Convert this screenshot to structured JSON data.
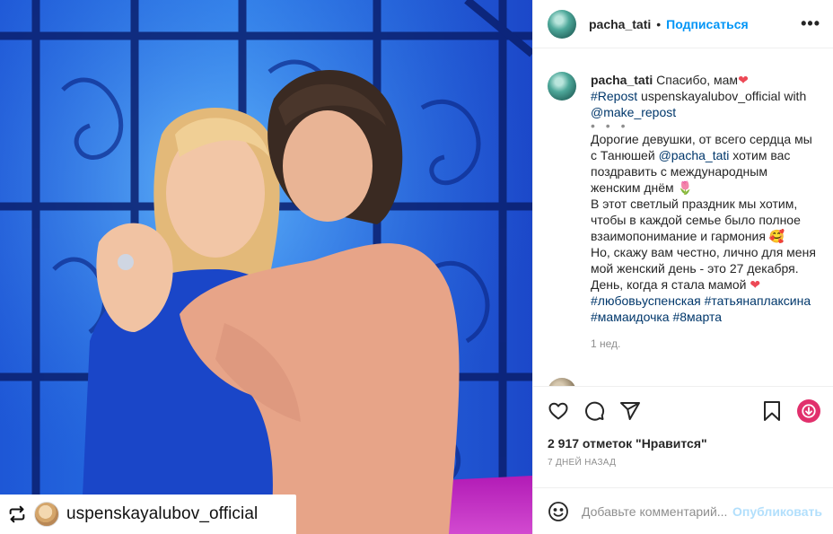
{
  "photo": {
    "repost_user": "uspenskayalubov_official",
    "alt": "Две женщины обнимаются на фоне синей студийной декорации"
  },
  "header": {
    "username": "pacha_tati",
    "separator": "•",
    "follow_label": "Подписаться",
    "more_label": "•••"
  },
  "caption": {
    "username": "pacha_tati",
    "lines": [
      {
        "pre": " Спасибо, мам",
        "heart": "❤"
      },
      {
        "tag": "#Repost",
        "rest": " uspenskayalubov_official with"
      },
      {
        "tag": "@make_repost"
      },
      {
        "bullets": "• • •"
      },
      {
        "text": "Дорогие девушки, от всего сердца мы"
      },
      {
        "pre": "с Танюшей ",
        "tag": "@pacha_tati",
        "rest": " хотим вас"
      },
      {
        "text": "поздравить с международным"
      },
      {
        "text": "женским днём ",
        "emoji": "🌷"
      },
      {
        "text": "В этот светлый праздник мы хотим,"
      },
      {
        "text": "чтобы в каждой семье было полное"
      },
      {
        "text": "взаимопонимание и гармония ",
        "emoji": "🥰"
      },
      {
        "text": "Но, скажу вам честно, лично для меня"
      },
      {
        "text": "мой женский день - это 27 декабря."
      },
      {
        "text": "День, когда я стала мамой ",
        "heart": "❤"
      },
      {
        "tags": "#любовьуспенская #татьянаплаксина"
      },
      {
        "tags": "#мамаидочка #8марта"
      }
    ],
    "time_ago": "1 нед."
  },
  "actions": {
    "likes": "2 917 отметок \"Нравится\"",
    "date": "7 ДНЕЙ НАЗАД"
  },
  "comment_box": {
    "placeholder": "Добавьте комментарий...",
    "publish_label": "Опубликовать"
  },
  "colors": {
    "accent": "#0095f6",
    "tag": "#00376b",
    "heart": "#ed4956",
    "muted": "#8e8e8e",
    "publish_disabled": "#b2dffc",
    "photo_bg": "#1c4fd1"
  }
}
